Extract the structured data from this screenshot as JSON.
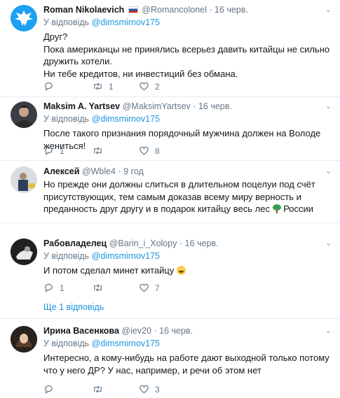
{
  "tweets": [
    {
      "name": "Roman Nikolaevich",
      "handle": "@Romancolonel",
      "sep": "·",
      "time": "16 черв.",
      "reply_prefix": "У відповідь",
      "reply_to": "@dimsmirnov175",
      "lines": [
        "Друг?",
        "Пока американцы не принялись всерьез давить китайцы не сильно дружить хотели.",
        "Ни тебе кредитов, ни инвестиций без обмана."
      ],
      "retweets": "1",
      "likes": "2"
    },
    {
      "name": "Maksim A. Yartsev",
      "handle": "@MaksimYartsev",
      "sep": "·",
      "time": "16 черв.",
      "reply_prefix": "У відповідь",
      "reply_to": "@dimsmirnov175",
      "lines": [
        "После такого признания порядочный мужчина должен на Володе жениться!"
      ],
      "replies": "1",
      "likes": "8"
    },
    {
      "name": "Алексей",
      "handle": "@Wble4",
      "sep": "·",
      "time": "9 год",
      "text_main": "Но прежде они должны слиться в длительном поцелуи под счёт присутствующих, тем самым доказав всему миру верность и преданность друг другу и в подарок китайцу весь лес",
      "text_tail": "России"
    },
    {
      "name": "Рабовладелец",
      "handle": "@Barin_i_Xolopy",
      "sep": "·",
      "time": "16 черв.",
      "reply_prefix": "У відповідь",
      "reply_to": "@dimsmirnov175",
      "text_main": "И потом сделал минет китайцу",
      "replies": "1",
      "likes": "7",
      "more_replies": "Ще 1 відповідь"
    },
    {
      "name": "Ирина Васенкова",
      "handle": "@iev20",
      "sep": "·",
      "time": "16 черв.",
      "reply_prefix": "У відповідь",
      "reply_to": "@dimsmirnov175",
      "lines": [
        "Интересно, а кому-нибудь на работе дают выходной только потому что  у него ДР? У нас, например, и речи об этом нет"
      ],
      "likes": "3"
    }
  ],
  "colors": {
    "link": "#1b95e0",
    "muted": "#657786",
    "separator": "#e6ecf0"
  }
}
